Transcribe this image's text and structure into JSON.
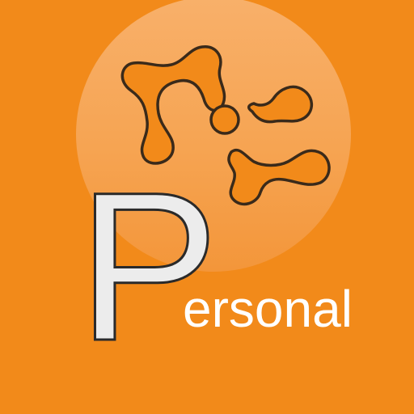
{
  "app_icon": {
    "background_color": "#f28a1a",
    "circle_color": "#f6a452",
    "mark_fill": "#f28a1a",
    "mark_stroke": "#3a2a1a",
    "letter_fill": "#ececec",
    "letter_stroke": "#2a2a2a",
    "logo_icon": "molecule-network-icon",
    "wordmark_initial": "P",
    "wordmark_rest": "ersonal"
  }
}
